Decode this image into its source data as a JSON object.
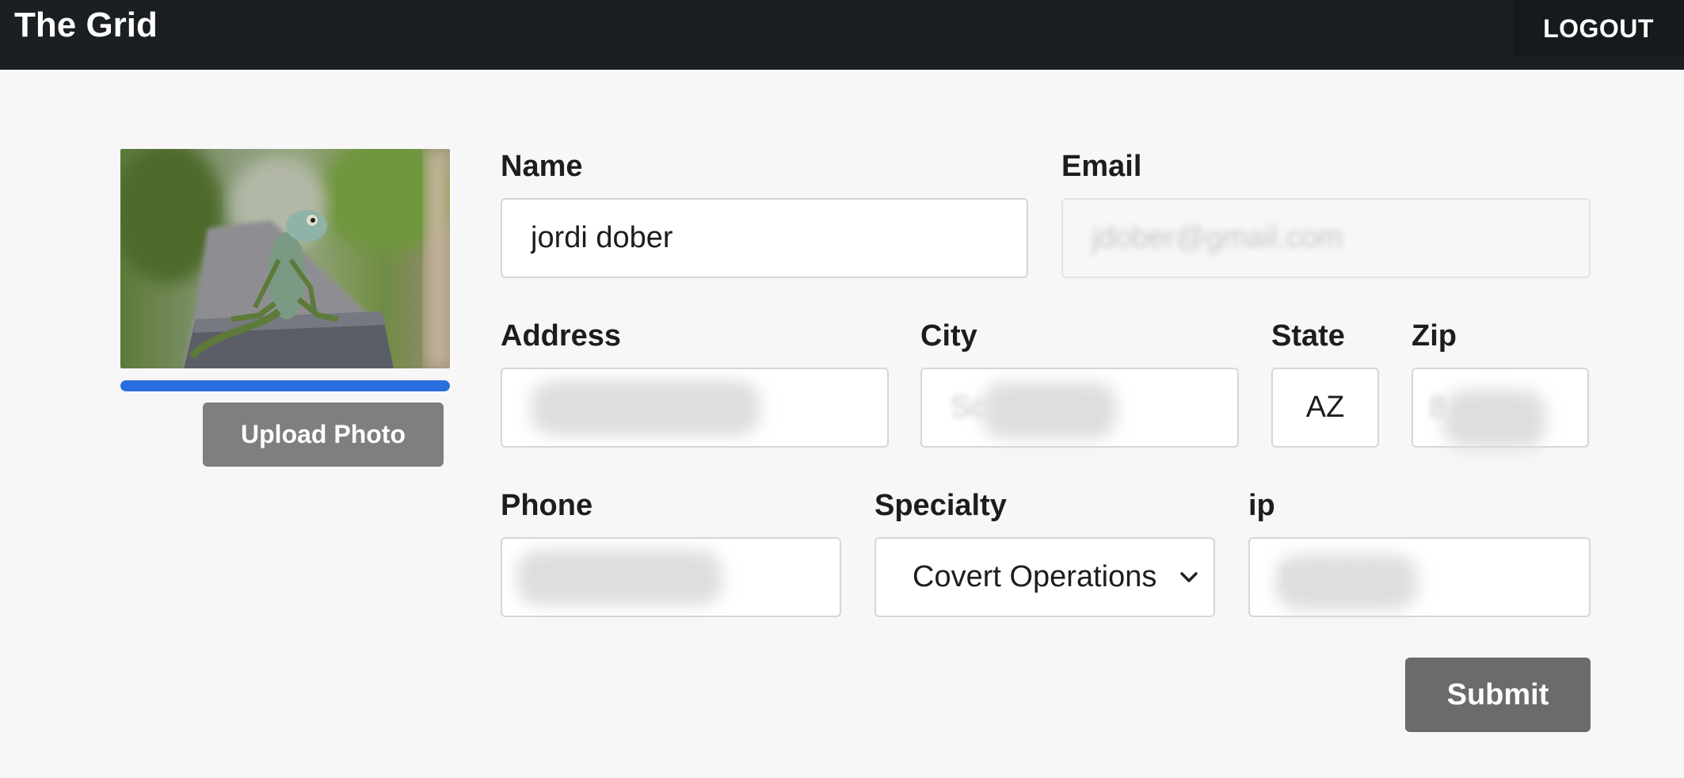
{
  "header": {
    "brand": "The Grid",
    "logout_label": "LOGOUT"
  },
  "profile": {
    "photo_icon": "lizard-photo",
    "upload_progress_percent": 100,
    "upload_label": "Upload Photo"
  },
  "form": {
    "name": {
      "label": "Name",
      "value": "jordi dober"
    },
    "email": {
      "label": "Email",
      "value": "jdober@gmail.com"
    },
    "address": {
      "label": "Address",
      "value": ""
    },
    "city": {
      "label": "City",
      "value": "Sc"
    },
    "state": {
      "label": "State",
      "value": "AZ"
    },
    "zip": {
      "label": "Zip",
      "value": "8"
    },
    "phone": {
      "label": "Phone",
      "value": ""
    },
    "specialty": {
      "label": "Specialty",
      "selected": "Covert Operations"
    },
    "ip": {
      "label": "ip",
      "value": "127.0.0.1"
    },
    "submit_label": "Submit"
  },
  "colors": {
    "header_bg": "#1b1f22",
    "progress": "#2a6dde",
    "button_gray": "#7f7f7f"
  }
}
